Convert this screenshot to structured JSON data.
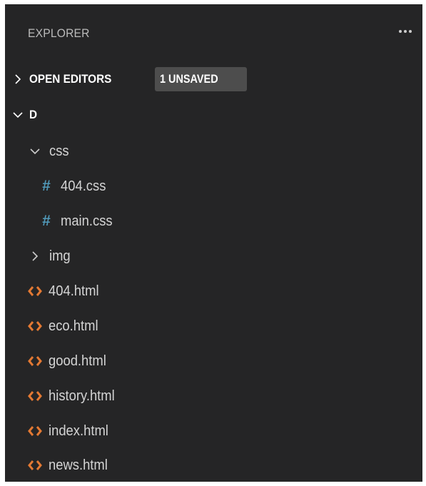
{
  "explorer": {
    "title": "EXPLORER"
  },
  "open_editors": {
    "title": "OPEN EDITORS",
    "badge": "1 UNSAVED"
  },
  "folder": {
    "name": "D",
    "items": [
      {
        "label": "css",
        "type": "folder",
        "expanded": true,
        "icon": "chevron-down-icon"
      },
      {
        "label": "404.css",
        "type": "css-file",
        "icon": "css-hash-icon"
      },
      {
        "label": "main.css",
        "type": "css-file",
        "icon": "css-hash-icon"
      },
      {
        "label": "img",
        "type": "folder",
        "expanded": false,
        "icon": "chevron-right-icon"
      },
      {
        "label": "404.html",
        "type": "html-file",
        "icon": "html-brackets-icon"
      },
      {
        "label": "eco.html",
        "type": "html-file",
        "icon": "html-brackets-icon"
      },
      {
        "label": "good.html",
        "type": "html-file",
        "icon": "html-brackets-icon"
      },
      {
        "label": "history.html",
        "type": "html-file",
        "icon": "html-brackets-icon"
      },
      {
        "label": "index.html",
        "type": "html-file",
        "icon": "html-brackets-icon"
      },
      {
        "label": "news.html",
        "type": "html-file",
        "icon": "html-brackets-icon"
      }
    ]
  },
  "colors": {
    "background": "#252526",
    "css_icon": "#519aba",
    "html_icon": "#e37933",
    "badge_bg": "#4d4d4d",
    "text": "#d4d4d4"
  }
}
